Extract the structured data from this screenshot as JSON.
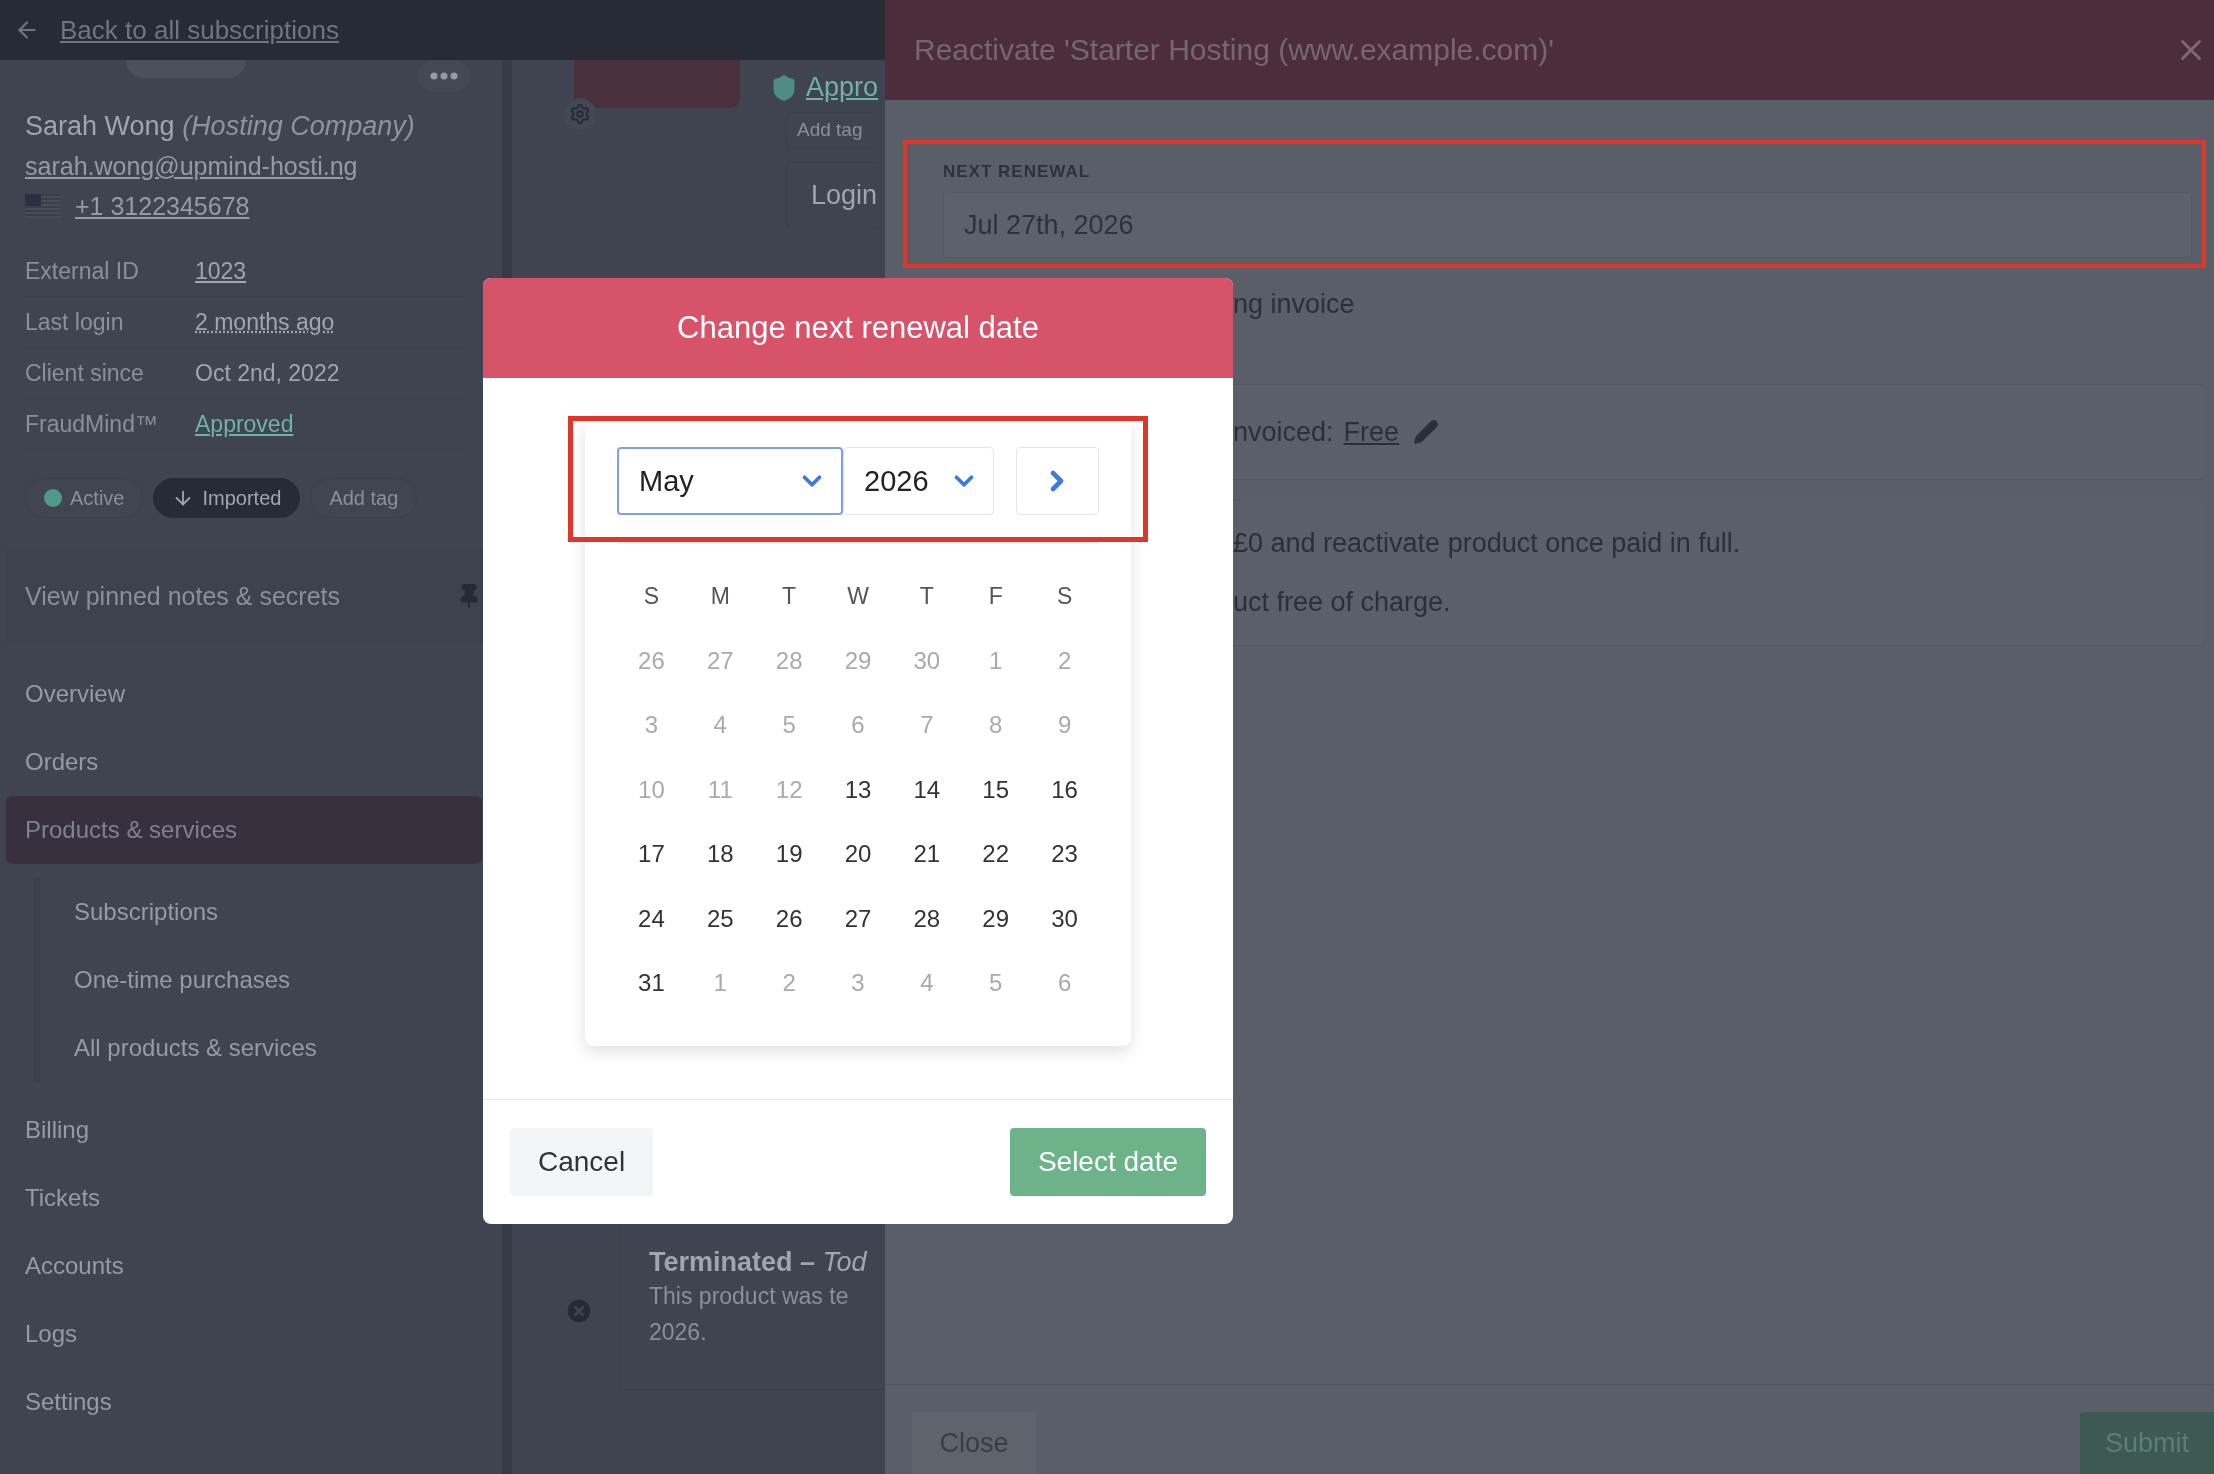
{
  "header": {
    "back_link": "Back to all subscriptions"
  },
  "client": {
    "name": "Sarah Wong",
    "company": "(Hosting Company)",
    "email": "sarah.wong@upmind-hosti.ng",
    "phone": "+1 3122345678",
    "details": [
      {
        "label": "External ID",
        "value": "1023",
        "kind": "link"
      },
      {
        "label": "Last login",
        "value": "2 months ago",
        "kind": "dotted"
      },
      {
        "label": "Client since",
        "value": "Oct 2nd, 2022",
        "kind": "plain"
      },
      {
        "label": "FraudMind™",
        "value": "Approved",
        "kind": "status"
      }
    ],
    "tags": [
      {
        "label": "Active",
        "kind": "status"
      },
      {
        "label": "Imported",
        "kind": "imported"
      },
      {
        "label": "Add tag",
        "kind": "add"
      }
    ],
    "pinned_notes": "View pinned notes & secrets"
  },
  "nav": [
    {
      "label": "Overview",
      "selected": false
    },
    {
      "label": "Orders",
      "selected": false
    },
    {
      "label": "Products & services",
      "selected": true,
      "children": [
        {
          "label": "Subscriptions",
          "selected": false
        },
        {
          "label": "One-time purchases",
          "selected": false
        },
        {
          "label": "All products & services",
          "selected": false
        }
      ]
    },
    {
      "label": "Billing",
      "selected": false
    },
    {
      "label": "Tickets",
      "selected": false
    },
    {
      "label": "Accounts",
      "selected": false
    },
    {
      "label": "Logs",
      "selected": false
    },
    {
      "label": "Settings",
      "selected": false
    }
  ],
  "middle": {
    "fraud_link": "Appro",
    "add_tag": "Add tag",
    "login_button": "Login",
    "timeline": {
      "title": "Terminated – ",
      "title_date": "Tod",
      "lines": [
        "This product was te",
        "2026."
      ]
    }
  },
  "drawer": {
    "title": "Reactivate 'Starter Hosting (www.example.com)'",
    "next_renewal": {
      "label": "NEXT RENEWAL",
      "value": "Jul 27th, 2026",
      "highlighted": true
    },
    "invoice_option": "ng invoice",
    "price_row": {
      "label": "nvoiced:",
      "link": "Free"
    },
    "options": [
      "£0 and reactivate product once paid in full.",
      "uct free of charge."
    ],
    "buttons": {
      "close": "Close",
      "submit": "Submit"
    }
  },
  "modal": {
    "title": "Change next renewal date",
    "month": "May",
    "year": "2026",
    "highlighted": true,
    "weekdays": [
      "S",
      "M",
      "T",
      "W",
      "T",
      "F",
      "S"
    ],
    "weeks": [
      [
        {
          "day": "26",
          "disabled": true
        },
        {
          "day": "27",
          "disabled": true
        },
        {
          "day": "28",
          "disabled": true
        },
        {
          "day": "29",
          "disabled": true
        },
        {
          "day": "30",
          "disabled": true
        },
        {
          "day": "1",
          "disabled": true
        },
        {
          "day": "2",
          "disabled": true
        }
      ],
      [
        {
          "day": "3",
          "disabled": true
        },
        {
          "day": "4",
          "disabled": true
        },
        {
          "day": "5",
          "disabled": true
        },
        {
          "day": "6",
          "disabled": true
        },
        {
          "day": "7",
          "disabled": true
        },
        {
          "day": "8",
          "disabled": true
        },
        {
          "day": "9",
          "disabled": true
        }
      ],
      [
        {
          "day": "10",
          "disabled": true
        },
        {
          "day": "11",
          "disabled": true
        },
        {
          "day": "12",
          "disabled": true
        },
        {
          "day": "13",
          "disabled": false
        },
        {
          "day": "14",
          "disabled": false
        },
        {
          "day": "15",
          "disabled": false
        },
        {
          "day": "16",
          "disabled": false
        }
      ],
      [
        {
          "day": "17",
          "disabled": false
        },
        {
          "day": "18",
          "disabled": false
        },
        {
          "day": "19",
          "disabled": false
        },
        {
          "day": "20",
          "disabled": false
        },
        {
          "day": "21",
          "disabled": false
        },
        {
          "day": "22",
          "disabled": false
        },
        {
          "day": "23",
          "disabled": false
        }
      ],
      [
        {
          "day": "24",
          "disabled": false
        },
        {
          "day": "25",
          "disabled": false
        },
        {
          "day": "26",
          "disabled": false
        },
        {
          "day": "27",
          "disabled": false
        },
        {
          "day": "28",
          "disabled": false
        },
        {
          "day": "29",
          "disabled": false
        },
        {
          "day": "30",
          "disabled": false
        }
      ],
      [
        {
          "day": "31",
          "disabled": false
        },
        {
          "day": "1",
          "disabled": true
        },
        {
          "day": "2",
          "disabled": true
        },
        {
          "day": "3",
          "disabled": true
        },
        {
          "day": "4",
          "disabled": true
        },
        {
          "day": "5",
          "disabled": true
        },
        {
          "day": "6",
          "disabled": true
        }
      ]
    ],
    "buttons": {
      "cancel": "Cancel",
      "select": "Select date"
    }
  }
}
